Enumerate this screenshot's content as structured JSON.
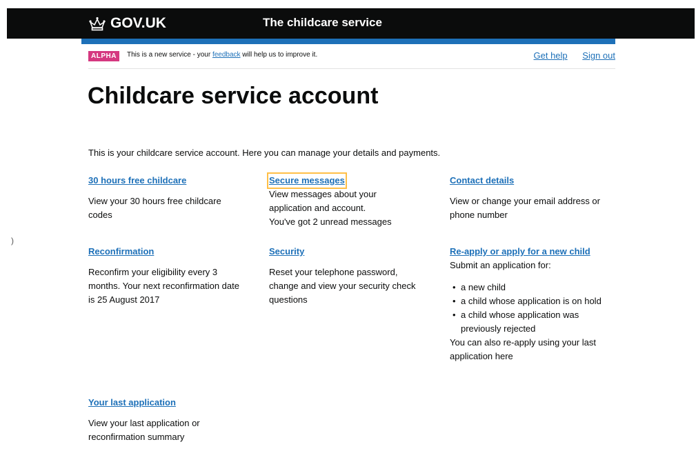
{
  "header": {
    "logo_text": "GOV.UK",
    "service_name": "The childcare service"
  },
  "phase_banner": {
    "tag": "ALPHA",
    "text_before": "This is a new service - your ",
    "feedback_link": "feedback",
    "text_after": " will help us to improve it.",
    "get_help": "Get help",
    "sign_out": "Sign out"
  },
  "page": {
    "title": "Childcare service account",
    "intro": "This is your childcare service account. Here you can manage your details and payments."
  },
  "sections": {
    "free_childcare": {
      "heading": "30 hours free childcare",
      "desc": "View your 30 hours free childcare codes"
    },
    "secure_messages": {
      "heading": "Secure messages",
      "desc": "View messages about your application and account.",
      "unread": "You've got 2 unread messages"
    },
    "contact_details": {
      "heading": "Contact details",
      "desc": "View or change your email address or phone number"
    },
    "reconfirmation": {
      "heading": "Reconfirmation",
      "desc": "Reconfirm your eligibility every 3 months. Your next reconfirmation date is 25 August 2017"
    },
    "security": {
      "heading": "Security",
      "desc": "Reset your telephone password, change and view your security check questions"
    },
    "reapply": {
      "heading": "Re-apply or apply for a new child",
      "intro": "Submit an application for:",
      "items": [
        "a new child",
        "a child whose application is on hold",
        "a child whose application was previously rejected"
      ],
      "outro": "You can also re-apply using your last application here"
    },
    "last_application": {
      "heading": "Your last application",
      "desc": "View your last application or reconfirmation summary"
    }
  },
  "colors": {
    "header_bg": "#0b0c0c",
    "brand_blue": "#1d70b8",
    "phase_tag": "#d53880",
    "focus": "#ffbf47"
  },
  "margin_glyph": ")"
}
